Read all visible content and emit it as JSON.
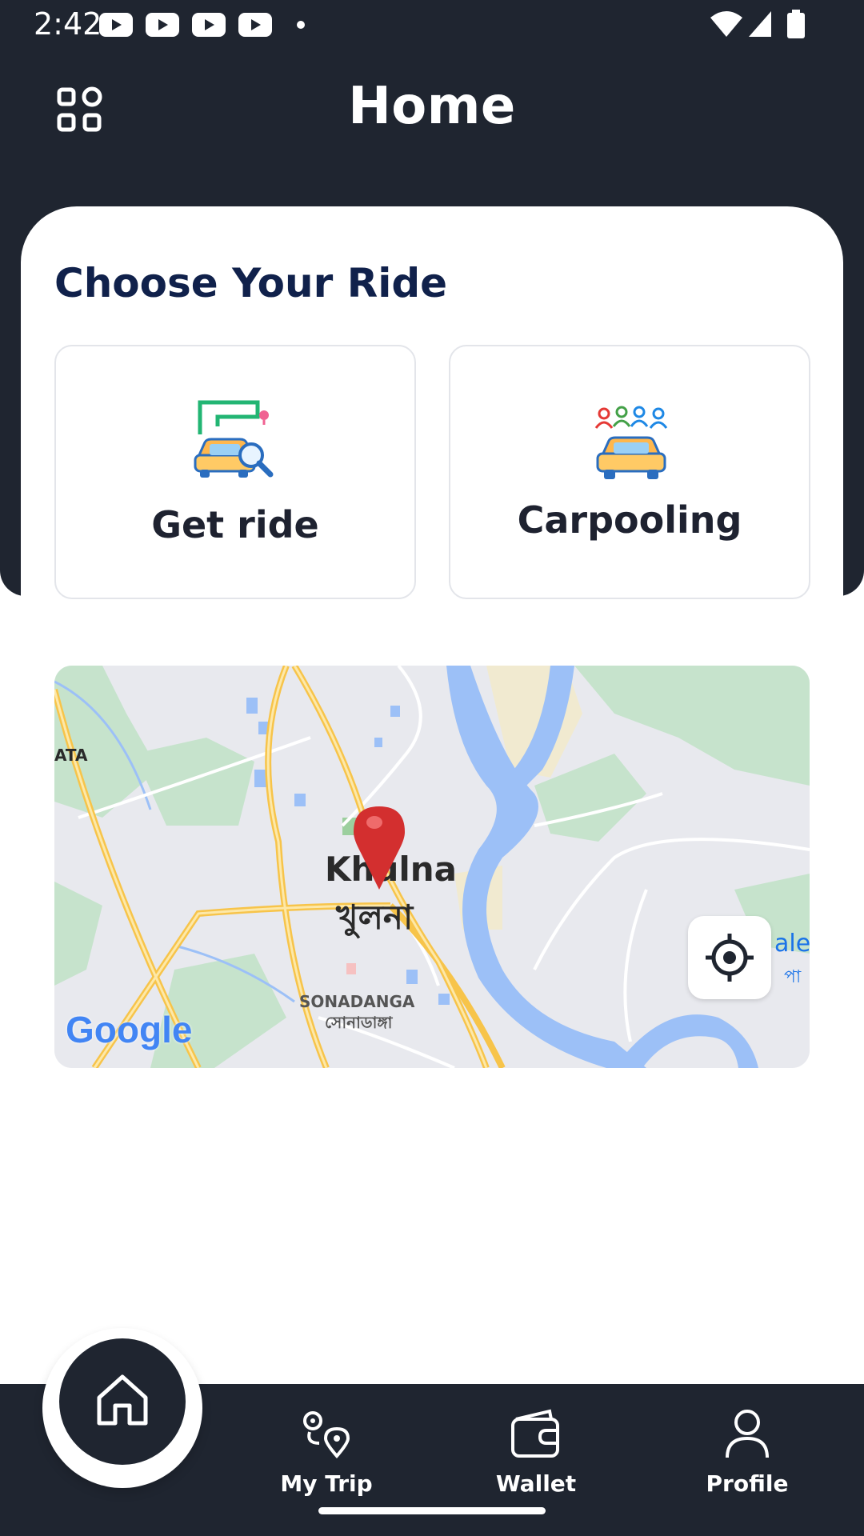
{
  "status_bar": {
    "time": "2:42"
  },
  "header": {
    "title": "Home",
    "menu_icon": "grid-menu-icon"
  },
  "main": {
    "section_title": "Choose Your Ride",
    "options": [
      {
        "label": "Get ride",
        "icon": "car-route-search-icon"
      },
      {
        "label": "Carpooling",
        "icon": "car-passengers-icon"
      }
    ]
  },
  "map": {
    "city_en": "Khulna",
    "city_bn": "খুলনা",
    "area_en": "SONADANGA",
    "area_bn": "সোনাডাঙ্গা",
    "edge_left": "ATA",
    "edge_right": "ale",
    "edge_right_bn": "পা",
    "attribution": "Google"
  },
  "bottom_nav": {
    "home_icon": "home-icon",
    "items": [
      {
        "label": "My Trip",
        "icon": "route-icon"
      },
      {
        "label": "Wallet",
        "icon": "wallet-icon"
      },
      {
        "label": "Profile",
        "icon": "person-icon"
      }
    ]
  },
  "colors": {
    "dark": "#1f2530",
    "title_navy": "#10214b",
    "pin_red": "#d32f2f"
  }
}
